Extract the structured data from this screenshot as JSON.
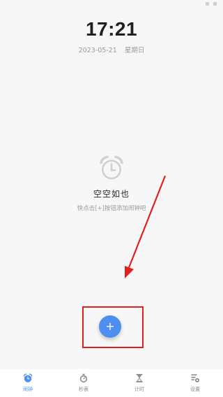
{
  "clock": {
    "time": "17:21",
    "date": "2023-05-21",
    "weekday": "星期日"
  },
  "empty_state": {
    "icon": "alarm-clock-icon",
    "title": "空空如也",
    "hint": "快点击[+]按钮添加闹钟吧"
  },
  "fab": {
    "label": "+",
    "icon": "plus-icon",
    "color": "#4d8ef0"
  },
  "annotation": {
    "color": "#e02020"
  },
  "nav": {
    "active_color": "#4d8ef0",
    "items": [
      {
        "label": "闹钟",
        "icon": "alarm-icon",
        "active": true
      },
      {
        "label": "秒表",
        "icon": "stopwatch-icon",
        "active": false
      },
      {
        "label": "计时",
        "icon": "hourglass-icon",
        "active": false
      },
      {
        "label": "设置",
        "icon": "settings-icon",
        "active": false
      }
    ]
  }
}
